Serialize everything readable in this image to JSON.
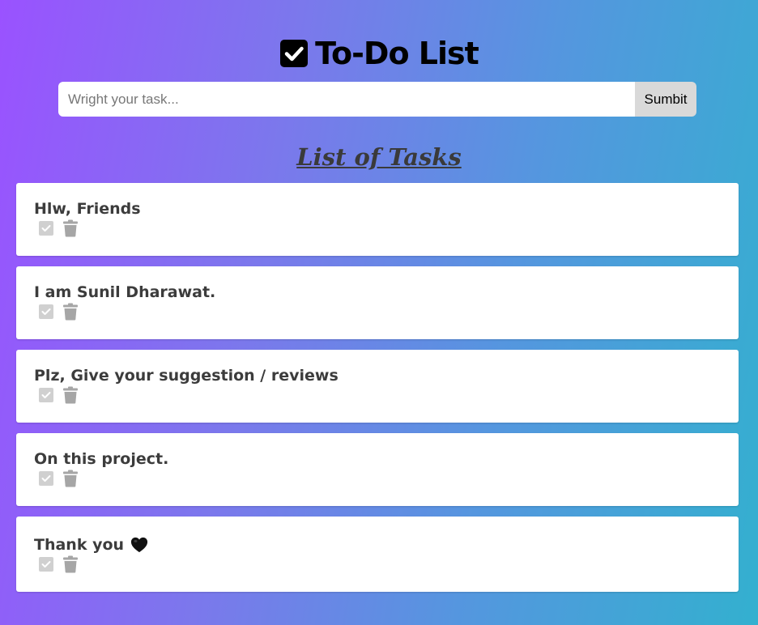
{
  "header": {
    "title": "To-Do List",
    "logo_icon": "check-square-icon"
  },
  "form": {
    "input_placeholder": "Wright your task...",
    "input_value": "",
    "submit_label": "Sumbit"
  },
  "list": {
    "heading": "List of Tasks",
    "tasks": [
      {
        "text": "Hlw, Friends",
        "icons": [
          "checkbox-icon",
          "trash-icon"
        ]
      },
      {
        "text": "I am Sunil Dharawat.",
        "icons": [
          "checkbox-icon",
          "trash-icon"
        ]
      },
      {
        "text": "Plz, Give your suggestion / reviews",
        "icons": [
          "checkbox-icon",
          "trash-icon"
        ]
      },
      {
        "text": "On this project.",
        "icons": [
          "checkbox-icon",
          "trash-icon"
        ]
      },
      {
        "text": "Thank you",
        "trailing_icon": "black-heart-icon",
        "icons": [
          "checkbox-icon",
          "trash-icon"
        ]
      }
    ]
  },
  "colors": {
    "gradient_start": "#9a52ff",
    "gradient_end": "#33b0cf",
    "icon_gray": "#a6a6a6",
    "checkbox_gray": "#d0d0d0",
    "submit_bg": "#d9d9d9"
  }
}
